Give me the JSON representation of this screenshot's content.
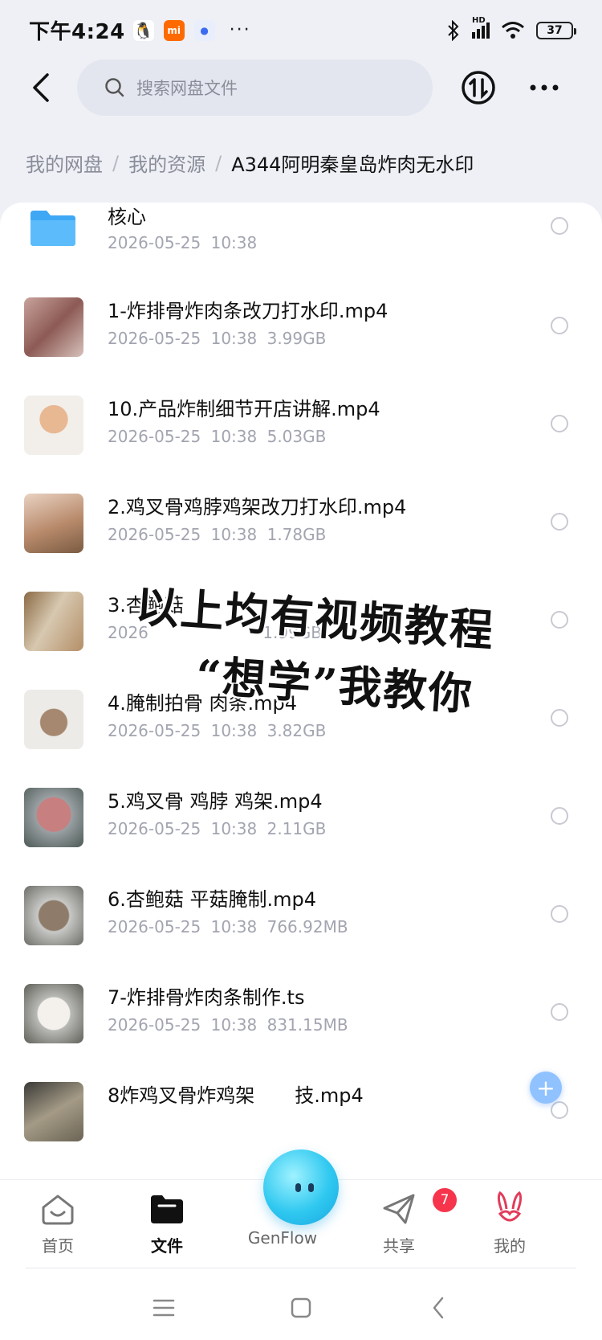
{
  "status_bar": {
    "time": "下午4:24",
    "app_icons": [
      "qq-icon",
      "mi-icon",
      "genflow-app-icon"
    ],
    "more": "···",
    "signal_label": "HD",
    "battery": "37"
  },
  "header": {
    "search_placeholder": "搜索网盘文件"
  },
  "breadcrumb": [
    "我的网盘",
    "我的资源",
    "A344阿明秦皇岛炸肉无水印"
  ],
  "files": [
    {
      "name": "核心",
      "date": "2026-05-25",
      "time": "10:38",
      "size": "",
      "type": "folder"
    },
    {
      "name": "1-炸排骨炸肉条改刀打水印.mp4",
      "date": "2026-05-25",
      "time": "10:38",
      "size": "3.99GB",
      "type": "video"
    },
    {
      "name": "10.产品炸制细节开店讲解.mp4",
      "date": "2026-05-25",
      "time": "10:38",
      "size": "5.03GB",
      "type": "video"
    },
    {
      "name": "2.鸡叉骨鸡脖鸡架改刀打水印.mp4",
      "date": "2026-05-25",
      "time": "10:38",
      "size": "1.78GB",
      "type": "video"
    },
    {
      "name": "3.杏鲍菇",
      "date": "2026",
      "time": "",
      "size": "1.99GB",
      "type": "video"
    },
    {
      "name": "4.腌制拍骨 肉条.mp4",
      "date": "2026-05-25",
      "time": "10:38",
      "size": "3.82GB",
      "type": "video"
    },
    {
      "name": "5.鸡叉骨 鸡脖 鸡架.mp4",
      "date": "2026-05-25",
      "time": "10:38",
      "size": "2.11GB",
      "type": "video"
    },
    {
      "name": "6.杏鲍菇 平菇腌制.mp4",
      "date": "2026-05-25",
      "time": "10:38",
      "size": "766.92MB",
      "type": "video"
    },
    {
      "name": "7-炸排骨炸肉条制作.ts",
      "date": "2026-05-25",
      "time": "10:38",
      "size": "831.15MB",
      "type": "video"
    },
    {
      "name": "8炸鸡叉骨炸鸡架",
      "date": "",
      "time": "",
      "size": "",
      "type": "video",
      "name_tail": "技.mp4"
    }
  ],
  "overlay": {
    "line1": "以上均有视频教程",
    "line2": "“想学”我教你"
  },
  "tabbar": {
    "tabs": [
      {
        "label": "首页",
        "icon": "home-icon"
      },
      {
        "label": "文件",
        "icon": "folder-icon"
      },
      {
        "label": "GenFlow",
        "icon": "genflow-orb-icon"
      },
      {
        "label": "共享",
        "icon": "paper-plane-icon"
      },
      {
        "label": "我的",
        "icon": "rabbit-icon"
      }
    ],
    "share_badge": "7"
  },
  "colors": {
    "accent": "#2fc8f0",
    "folder": "#3ea8f5",
    "badge": "#f6354c"
  }
}
